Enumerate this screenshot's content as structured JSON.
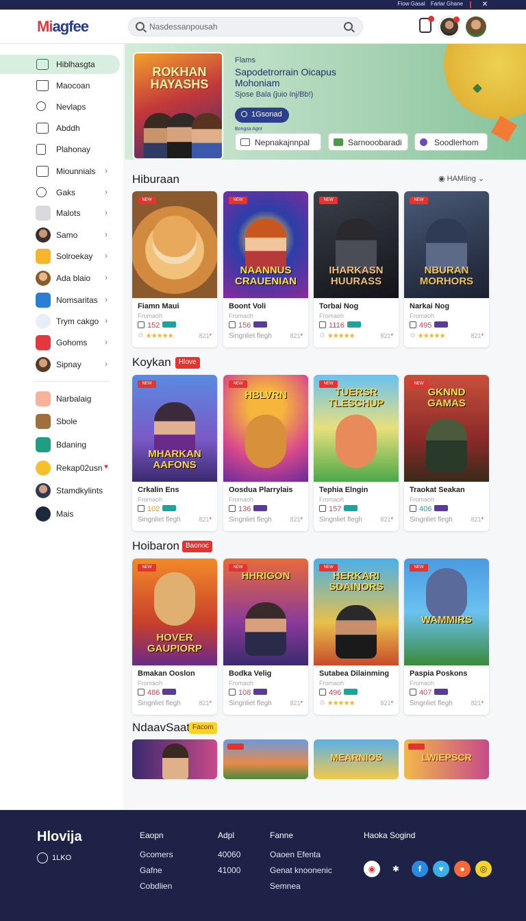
{
  "topbar": {
    "links": [
      "Fiow Gasal",
      "Farlar Ghane"
    ],
    "close_icon": "close-icon"
  },
  "header": {
    "logo_part1": "Mi",
    "logo_part2": "agfee",
    "search": {
      "placeholder": "Nasdessanpousah"
    },
    "icons": [
      "search-icon",
      "notification-icon",
      "avatar",
      "avatar"
    ]
  },
  "sidebar": {
    "items": [
      {
        "label": "Hiblhasgta",
        "icon": "bookmark-icon",
        "active": true
      },
      {
        "label": "Maocoan",
        "icon": "home-icon"
      },
      {
        "label": "Nevlaps",
        "icon": "search-icon"
      },
      {
        "label": "Abddh",
        "icon": "box-icon"
      },
      {
        "label": "Plahonay",
        "icon": "file-icon"
      },
      {
        "label": "Miounnials",
        "icon": "grid-icon",
        "chevron": true
      },
      {
        "label": "Gaks",
        "icon": "globe-icon",
        "chevron": true
      },
      {
        "label": "Malots",
        "icon": "list-icon",
        "chevron": true
      },
      {
        "label": "Samo",
        "icon": "avatar",
        "chevron": true
      },
      {
        "label": "Solroekay",
        "icon": "emoji-icon",
        "chevron": true
      },
      {
        "label": "Ada blaio",
        "icon": "avatar",
        "chevron": true
      },
      {
        "label": "Nomsaritas",
        "icon": "chat-icon",
        "chevron": true
      },
      {
        "label": "Trym cakgo",
        "icon": "drop-icon",
        "chevron": true
      },
      {
        "label": "Gohoms",
        "icon": "card-icon",
        "chevron": true
      },
      {
        "label": "Sipnay",
        "icon": "avatar",
        "chevron": true
      }
    ],
    "bottom_items": [
      {
        "label": "Narbalaig"
      },
      {
        "label": "Sbole"
      },
      {
        "label": "Bdaning"
      },
      {
        "label": "Rekap02usn"
      },
      {
        "label": "Stamdkylints"
      },
      {
        "label": "Mais"
      }
    ]
  },
  "hero": {
    "poster_title": "ROKHAN HAYASHS",
    "line1": "Flams",
    "line2": "Sapodetrorrain Oicapus",
    "line3": "Mohoniam",
    "line4": "Sjose Bala (juio Inj/Bb!)",
    "button": "1Gsonad",
    "small_text": "Bongsa Agnr",
    "pills": [
      "Nepnakajnnpal",
      "Sarnooobaradi",
      "Soodlerhom"
    ]
  },
  "sections": [
    {
      "title": "Hiburaan",
      "sort": "HAMIing",
      "cards": [
        {
          "art_title": "",
          "name": "Fiamn Maui",
          "sub": "Fromaoh",
          "num": "152",
          "bottom": "stars",
          "price": "821"
        },
        {
          "art_title": "NAANNUS CRAUENIAN",
          "name": "Boont Voli",
          "sub": "Fromaoh",
          "num": "156",
          "bottom": "Singnliet flegh",
          "price": "821"
        },
        {
          "art_title": "IHARKASN HUURASS",
          "name": "Torbai Nog",
          "sub": "Fromaoh",
          "num": "1116",
          "bottom": "stars",
          "price": "821"
        },
        {
          "art_title": "NBURAN MORHORS",
          "name": "Narkai Nog",
          "sub": "Fromaoh",
          "num": "495",
          "bottom": "stars",
          "price": "821"
        }
      ]
    },
    {
      "title": "Koykan",
      "badge": "Hlove",
      "cards": [
        {
          "art_title": "MHARKAN AAFONS",
          "name": "Crkalin Ens",
          "sub": "Fromaoh",
          "num": "102",
          "bottom": "Singnliet flegh",
          "price": "821"
        },
        {
          "art_title": "HBLVRN",
          "name": "Oosdua Plarrylais",
          "sub": "Fromaoh",
          "num": "136",
          "bottom": "Singnliet flegh",
          "price": "821"
        },
        {
          "art_title": "TUERSR TLESCHUP",
          "name": "Tephia Elngin",
          "sub": "Fromaoh",
          "num": "157",
          "bottom": "Singnliet flegh",
          "price": "821"
        },
        {
          "art_title": "GKNND GAMAS",
          "name": "Traokat Seakan",
          "sub": "Fromaoh",
          "num": "406",
          "bottom": "Singnliet flegh",
          "price": "821"
        }
      ]
    },
    {
      "title": "Hoibaron",
      "badge": "Baonoc",
      "cards": [
        {
          "art_title": "HOVER GAUPIORP",
          "name": "Bmakan Ooslon",
          "sub": "Fromaoh",
          "num": "486",
          "bottom": "Singnliet flegh",
          "price": "821"
        },
        {
          "art_title": "HHRIGON",
          "name": "Bodka Velig",
          "sub": "Fromaoh",
          "num": "108",
          "bottom": "Singnliet flegh",
          "price": "821"
        },
        {
          "art_title": "HERKARI SDAINORS",
          "name": "Sutabea Dilainming",
          "sub": "Fromaoh",
          "num": "496",
          "bottom": "stars",
          "price": "821"
        },
        {
          "art_title": "WAMMIRS",
          "name": "Paspia Poskons",
          "sub": "Fromaoh",
          "num": "407",
          "bottom": "Singnliet flegh",
          "price": "821"
        }
      ]
    },
    {
      "title": "NdaavSaat",
      "badge": "Facom",
      "strips": [
        "",
        "",
        "MEARNIOS",
        "LWIEPSCR"
      ]
    }
  ],
  "footer": {
    "logo": "Hlovija",
    "lang": "1LKO",
    "cols": [
      {
        "head": "Eaopn",
        "items": [
          "Gcomers",
          "Gafne",
          "Cobdlien"
        ]
      },
      {
        "head": "Adpl",
        "items": [
          "40060",
          "41000"
        ]
      },
      {
        "head": "Fanne",
        "items": [
          "Oaoen Efenta",
          "Genat knoonenic",
          "Semnea"
        ]
      }
    ],
    "social_title": "Haoka Sogind",
    "social": [
      "app-icon",
      "star-icon",
      "facebook-icon",
      "twitter-icon",
      "chat-icon",
      "snapchat-icon"
    ]
  },
  "colors": {
    "accent": "#e3342f",
    "brand": "#243a8c",
    "footer": "#1d2246",
    "active": "#d8eee0"
  }
}
